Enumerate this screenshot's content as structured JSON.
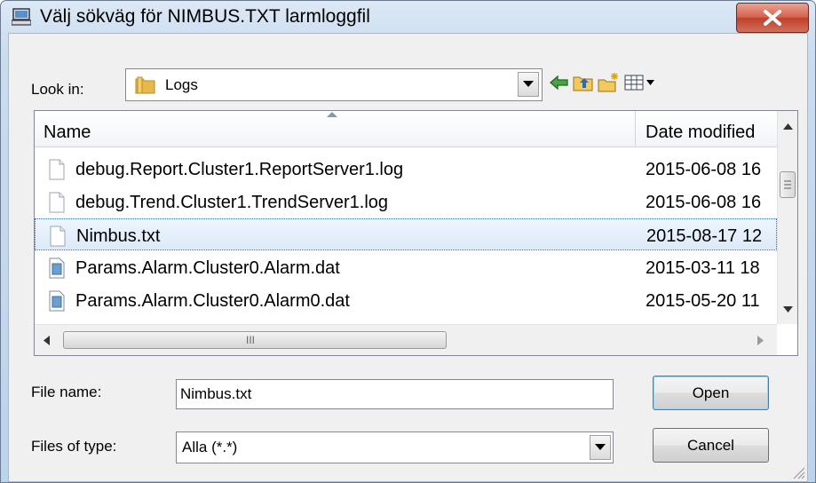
{
  "window": {
    "title": "Välj sökväg för NIMBUS.TXT larmloggfil"
  },
  "toolbar": {
    "look_in_label": "Look in:",
    "look_in_value": "Logs",
    "icons": [
      "back-arrow-icon",
      "up-folder-icon",
      "new-folder-icon",
      "view-menu-icon"
    ]
  },
  "list": {
    "columns": {
      "name": "Name",
      "date": "Date modified"
    },
    "rows": [
      {
        "name": "debug.Report.Cluster1.ReportServer1.log",
        "date": "2015-06-08 16",
        "icon": "text-file-icon",
        "selected": false
      },
      {
        "name": "debug.Trend.Cluster1.TrendServer1.log",
        "date": "2015-06-08 16",
        "icon": "text-file-icon",
        "selected": false
      },
      {
        "name": "Nimbus.txt",
        "date": "2015-08-17 12",
        "icon": "text-file-icon",
        "selected": true
      },
      {
        "name": "Params.Alarm.Cluster0.Alarm.dat",
        "date": "2015-03-11 18",
        "icon": "data-file-icon",
        "selected": false
      },
      {
        "name": "Params.Alarm.Cluster0.Alarm0.dat",
        "date": "2015-05-20 11",
        "icon": "data-file-icon",
        "selected": false
      }
    ],
    "hscroll_grip": "III"
  },
  "form": {
    "file_name_label": "File name:",
    "file_name_value": "Nimbus.txt",
    "file_type_label": "Files of type:",
    "file_type_value": "Alla (*.*)"
  },
  "buttons": {
    "open": "Open",
    "cancel": "Cancel"
  },
  "colors": {
    "selection": "#dceaf9",
    "close_button": "#c0402b",
    "folder": "#e8b94a"
  }
}
